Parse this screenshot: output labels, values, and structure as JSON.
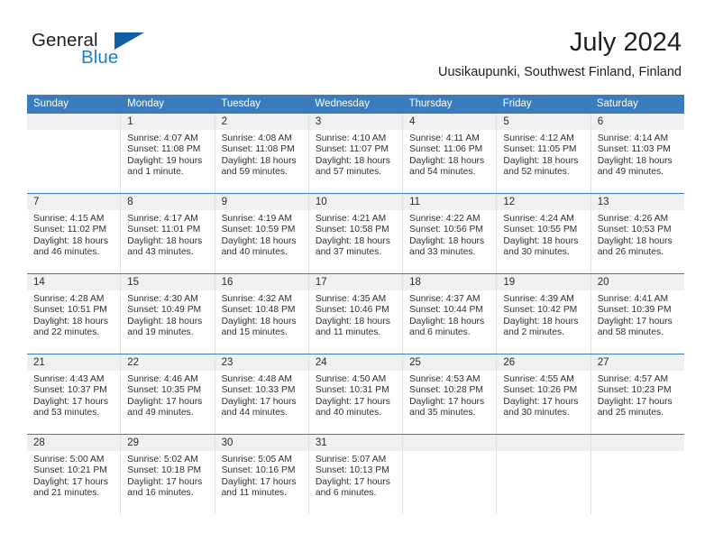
{
  "brand": {
    "name_part1": "General",
    "name_part2": "Blue",
    "flag_color": "#0d5fa8",
    "blue_text_color": "#1a7fd4"
  },
  "header": {
    "title": "July 2024",
    "subtitle": "Uusikaupunki, Southwest Finland, Finland"
  },
  "theme": {
    "header_bg": "#3a7cbe",
    "daynum_bg": "#f0f0f0",
    "week_rule": "#3a7cbe",
    "cell_border": "#e2e2e2"
  },
  "calendar": {
    "day_headers": [
      "Sunday",
      "Monday",
      "Tuesday",
      "Wednesday",
      "Thursday",
      "Friday",
      "Saturday"
    ],
    "weeks": [
      [
        {
          "day": "",
          "sunrise": "",
          "sunset": "",
          "daylight": "",
          "empty": true
        },
        {
          "day": "1",
          "sunrise": "Sunrise: 4:07 AM",
          "sunset": "Sunset: 11:08 PM",
          "daylight": "Daylight: 19 hours and 1 minute."
        },
        {
          "day": "2",
          "sunrise": "Sunrise: 4:08 AM",
          "sunset": "Sunset: 11:08 PM",
          "daylight": "Daylight: 18 hours and 59 minutes."
        },
        {
          "day": "3",
          "sunrise": "Sunrise: 4:10 AM",
          "sunset": "Sunset: 11:07 PM",
          "daylight": "Daylight: 18 hours and 57 minutes."
        },
        {
          "day": "4",
          "sunrise": "Sunrise: 4:11 AM",
          "sunset": "Sunset: 11:06 PM",
          "daylight": "Daylight: 18 hours and 54 minutes."
        },
        {
          "day": "5",
          "sunrise": "Sunrise: 4:12 AM",
          "sunset": "Sunset: 11:05 PM",
          "daylight": "Daylight: 18 hours and 52 minutes."
        },
        {
          "day": "6",
          "sunrise": "Sunrise: 4:14 AM",
          "sunset": "Sunset: 11:03 PM",
          "daylight": "Daylight: 18 hours and 49 minutes."
        }
      ],
      [
        {
          "day": "7",
          "sunrise": "Sunrise: 4:15 AM",
          "sunset": "Sunset: 11:02 PM",
          "daylight": "Daylight: 18 hours and 46 minutes."
        },
        {
          "day": "8",
          "sunrise": "Sunrise: 4:17 AM",
          "sunset": "Sunset: 11:01 PM",
          "daylight": "Daylight: 18 hours and 43 minutes."
        },
        {
          "day": "9",
          "sunrise": "Sunrise: 4:19 AM",
          "sunset": "Sunset: 10:59 PM",
          "daylight": "Daylight: 18 hours and 40 minutes."
        },
        {
          "day": "10",
          "sunrise": "Sunrise: 4:21 AM",
          "sunset": "Sunset: 10:58 PM",
          "daylight": "Daylight: 18 hours and 37 minutes."
        },
        {
          "day": "11",
          "sunrise": "Sunrise: 4:22 AM",
          "sunset": "Sunset: 10:56 PM",
          "daylight": "Daylight: 18 hours and 33 minutes."
        },
        {
          "day": "12",
          "sunrise": "Sunrise: 4:24 AM",
          "sunset": "Sunset: 10:55 PM",
          "daylight": "Daylight: 18 hours and 30 minutes."
        },
        {
          "day": "13",
          "sunrise": "Sunrise: 4:26 AM",
          "sunset": "Sunset: 10:53 PM",
          "daylight": "Daylight: 18 hours and 26 minutes."
        }
      ],
      [
        {
          "day": "14",
          "sunrise": "Sunrise: 4:28 AM",
          "sunset": "Sunset: 10:51 PM",
          "daylight": "Daylight: 18 hours and 22 minutes."
        },
        {
          "day": "15",
          "sunrise": "Sunrise: 4:30 AM",
          "sunset": "Sunset: 10:49 PM",
          "daylight": "Daylight: 18 hours and 19 minutes."
        },
        {
          "day": "16",
          "sunrise": "Sunrise: 4:32 AM",
          "sunset": "Sunset: 10:48 PM",
          "daylight": "Daylight: 18 hours and 15 minutes."
        },
        {
          "day": "17",
          "sunrise": "Sunrise: 4:35 AM",
          "sunset": "Sunset: 10:46 PM",
          "daylight": "Daylight: 18 hours and 11 minutes."
        },
        {
          "day": "18",
          "sunrise": "Sunrise: 4:37 AM",
          "sunset": "Sunset: 10:44 PM",
          "daylight": "Daylight: 18 hours and 6 minutes."
        },
        {
          "day": "19",
          "sunrise": "Sunrise: 4:39 AM",
          "sunset": "Sunset: 10:42 PM",
          "daylight": "Daylight: 18 hours and 2 minutes."
        },
        {
          "day": "20",
          "sunrise": "Sunrise: 4:41 AM",
          "sunset": "Sunset: 10:39 PM",
          "daylight": "Daylight: 17 hours and 58 minutes."
        }
      ],
      [
        {
          "day": "21",
          "sunrise": "Sunrise: 4:43 AM",
          "sunset": "Sunset: 10:37 PM",
          "daylight": "Daylight: 17 hours and 53 minutes."
        },
        {
          "day": "22",
          "sunrise": "Sunrise: 4:46 AM",
          "sunset": "Sunset: 10:35 PM",
          "daylight": "Daylight: 17 hours and 49 minutes."
        },
        {
          "day": "23",
          "sunrise": "Sunrise: 4:48 AM",
          "sunset": "Sunset: 10:33 PM",
          "daylight": "Daylight: 17 hours and 44 minutes."
        },
        {
          "day": "24",
          "sunrise": "Sunrise: 4:50 AM",
          "sunset": "Sunset: 10:31 PM",
          "daylight": "Daylight: 17 hours and 40 minutes."
        },
        {
          "day": "25",
          "sunrise": "Sunrise: 4:53 AM",
          "sunset": "Sunset: 10:28 PM",
          "daylight": "Daylight: 17 hours and 35 minutes."
        },
        {
          "day": "26",
          "sunrise": "Sunrise: 4:55 AM",
          "sunset": "Sunset: 10:26 PM",
          "daylight": "Daylight: 17 hours and 30 minutes."
        },
        {
          "day": "27",
          "sunrise": "Sunrise: 4:57 AM",
          "sunset": "Sunset: 10:23 PM",
          "daylight": "Daylight: 17 hours and 25 minutes."
        }
      ],
      [
        {
          "day": "28",
          "sunrise": "Sunrise: 5:00 AM",
          "sunset": "Sunset: 10:21 PM",
          "daylight": "Daylight: 17 hours and 21 minutes."
        },
        {
          "day": "29",
          "sunrise": "Sunrise: 5:02 AM",
          "sunset": "Sunset: 10:18 PM",
          "daylight": "Daylight: 17 hours and 16 minutes."
        },
        {
          "day": "30",
          "sunrise": "Sunrise: 5:05 AM",
          "sunset": "Sunset: 10:16 PM",
          "daylight": "Daylight: 17 hours and 11 minutes."
        },
        {
          "day": "31",
          "sunrise": "Sunrise: 5:07 AM",
          "sunset": "Sunset: 10:13 PM",
          "daylight": "Daylight: 17 hours and 6 minutes."
        },
        {
          "day": "",
          "sunrise": "",
          "sunset": "",
          "daylight": "",
          "empty": true
        },
        {
          "day": "",
          "sunrise": "",
          "sunset": "",
          "daylight": "",
          "empty": true
        },
        {
          "day": "",
          "sunrise": "",
          "sunset": "",
          "daylight": "",
          "empty": true
        }
      ]
    ]
  }
}
